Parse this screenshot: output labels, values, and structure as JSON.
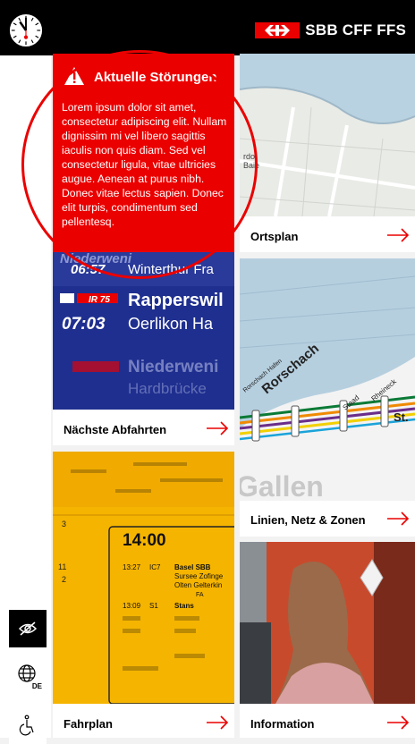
{
  "header": {
    "brand_text": "SBB CFF FFS",
    "clock_icon": "station-clock-icon",
    "logo_icon": "sbb-logo-arrows-icon"
  },
  "alert": {
    "title": "Aktuelle Störungen",
    "body": "Lorem ipsum dolor sit amet, consectetur adipiscing elit. Nullam dignissim mi vel libero sagittis iaculis non quis diam. Sed vel consectetur ligula, vitae ultricies augue. Aenean at purus nibh. Donec vitae lectus sapien. Donec elit turpis, condimentum sed pellentesq.",
    "icon": "warning-triangle-icon"
  },
  "tiles": {
    "departures": {
      "label": "Nächste Abfahrten",
      "board": {
        "row1_time": "06:57",
        "row1_dest": "Winterthur Fra",
        "row2_train": "IR 75",
        "row2_dest": "Rapperswil",
        "row2_time": "07:03",
        "row2_via": "Oerlikon Ha",
        "row3_dest": "Niederweni",
        "row3_via": "Hardbrücke"
      }
    },
    "timetable": {
      "label": "Fahrplan",
      "board": {
        "big_time": "14:00",
        "track_a": "3",
        "track_b": "11",
        "track_c": "2",
        "r1_time": "13:27",
        "r1_train": "IC7",
        "r1_dest": "Basel SBB",
        "r1_via": "Sursee Zofinge",
        "r1_via2": "Olten Gelterkin",
        "r1_extra": "FA",
        "r2_time": "13:09",
        "r2_train": "S1",
        "r2_dest": "Stans"
      }
    },
    "map": {
      "label": "Ortsplan"
    },
    "network": {
      "label": "Linien, Netz & Zonen",
      "map_text": {
        "city": "Rorschach",
        "city_small": "Rorschach Hafen",
        "station1": "Staad",
        "station2": "Rheineck",
        "station3": "St.",
        "big": "Gallen"
      }
    },
    "information": {
      "label": "Information"
    }
  },
  "sidebar": {
    "hide_icon": "eye-slash-icon",
    "language_icon": "globe-icon",
    "language_code": "DE",
    "accessibility_icon": "wheelchair-icon"
  },
  "colors": {
    "sbb_red": "#eb0000",
    "board_blue": "#1f2f8f",
    "board_yellow": "#f5b400",
    "black": "#000000"
  }
}
